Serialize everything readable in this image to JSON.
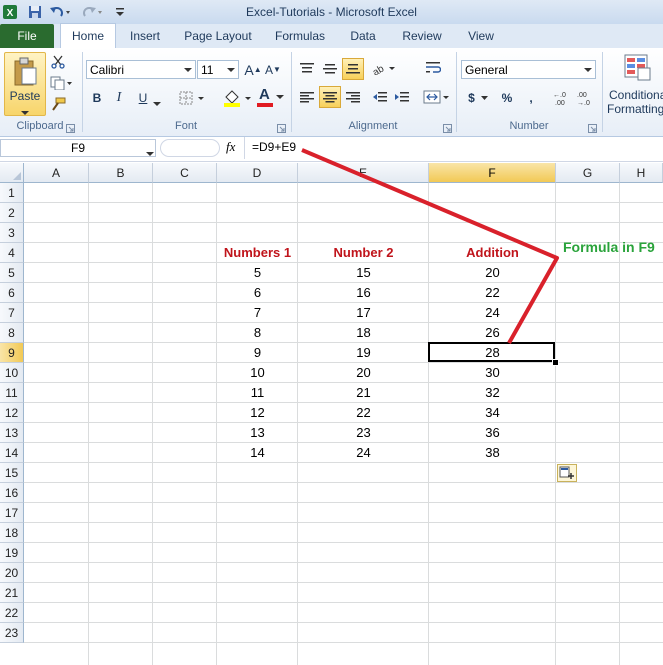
{
  "window": {
    "title": "Excel-Tutorials  -  Microsoft Excel"
  },
  "tabs": [
    "File",
    "Home",
    "Insert",
    "Page Layout",
    "Formulas",
    "Data",
    "Review",
    "View"
  ],
  "ribbon": {
    "clipboard": {
      "paste_label": "Paste",
      "group_label": "Clipboard"
    },
    "font": {
      "name": "Calibri",
      "size": "11",
      "bold": "B",
      "italic": "I",
      "underline": "U",
      "grow": "A",
      "shrink": "A",
      "font_color": "A",
      "group_label": "Font"
    },
    "alignment": {
      "group_label": "Alignment"
    },
    "number": {
      "format": "General",
      "currency": "$",
      "percent": "%",
      "comma": ",",
      "inc_decimal": ".0→.00",
      "dec_decimal": ".00→.0",
      "group_label": "Number"
    },
    "styles": {
      "conditional_line1": "Conditional",
      "conditional_line2": "Formatting"
    }
  },
  "formula_bar": {
    "name_box": "F9",
    "fx": "fx",
    "formula": "=D9+E9"
  },
  "sheet": {
    "columns": [
      "A",
      "B",
      "C",
      "D",
      "E",
      "F",
      "G",
      "H"
    ],
    "rows": [
      "1",
      "2",
      "3",
      "4",
      "5",
      "6",
      "7",
      "8",
      "9",
      "10",
      "11",
      "12",
      "13",
      "14",
      "15",
      "16",
      "17",
      "18",
      "19",
      "20",
      "21",
      "22",
      "23"
    ],
    "selected_cell": "F9",
    "header_row": {
      "d": "Numbers 1",
      "e": "Number 2",
      "f": "Addition"
    },
    "data": [
      {
        "row": "5",
        "d": "5",
        "e": "15",
        "f": "20"
      },
      {
        "row": "6",
        "d": "6",
        "e": "16",
        "f": "22"
      },
      {
        "row": "7",
        "d": "7",
        "e": "17",
        "f": "24"
      },
      {
        "row": "8",
        "d": "8",
        "e": "18",
        "f": "26"
      },
      {
        "row": "9",
        "d": "9",
        "e": "19",
        "f": "28"
      },
      {
        "row": "10",
        "d": "10",
        "e": "20",
        "f": "30"
      },
      {
        "row": "11",
        "d": "11",
        "e": "21",
        "f": "32"
      },
      {
        "row": "12",
        "d": "12",
        "e": "22",
        "f": "34"
      },
      {
        "row": "13",
        "d": "13",
        "e": "23",
        "f": "36"
      },
      {
        "row": "14",
        "d": "14",
        "e": "24",
        "f": "38"
      }
    ]
  },
  "annotation": {
    "text": "Formula in F9",
    "color": "#2aa33b",
    "arrow_color": "#d9212b"
  },
  "colors": {
    "header_text": "#c0141b",
    "file_tab": "#2a6b2f",
    "selected_header": "#f2c955"
  }
}
